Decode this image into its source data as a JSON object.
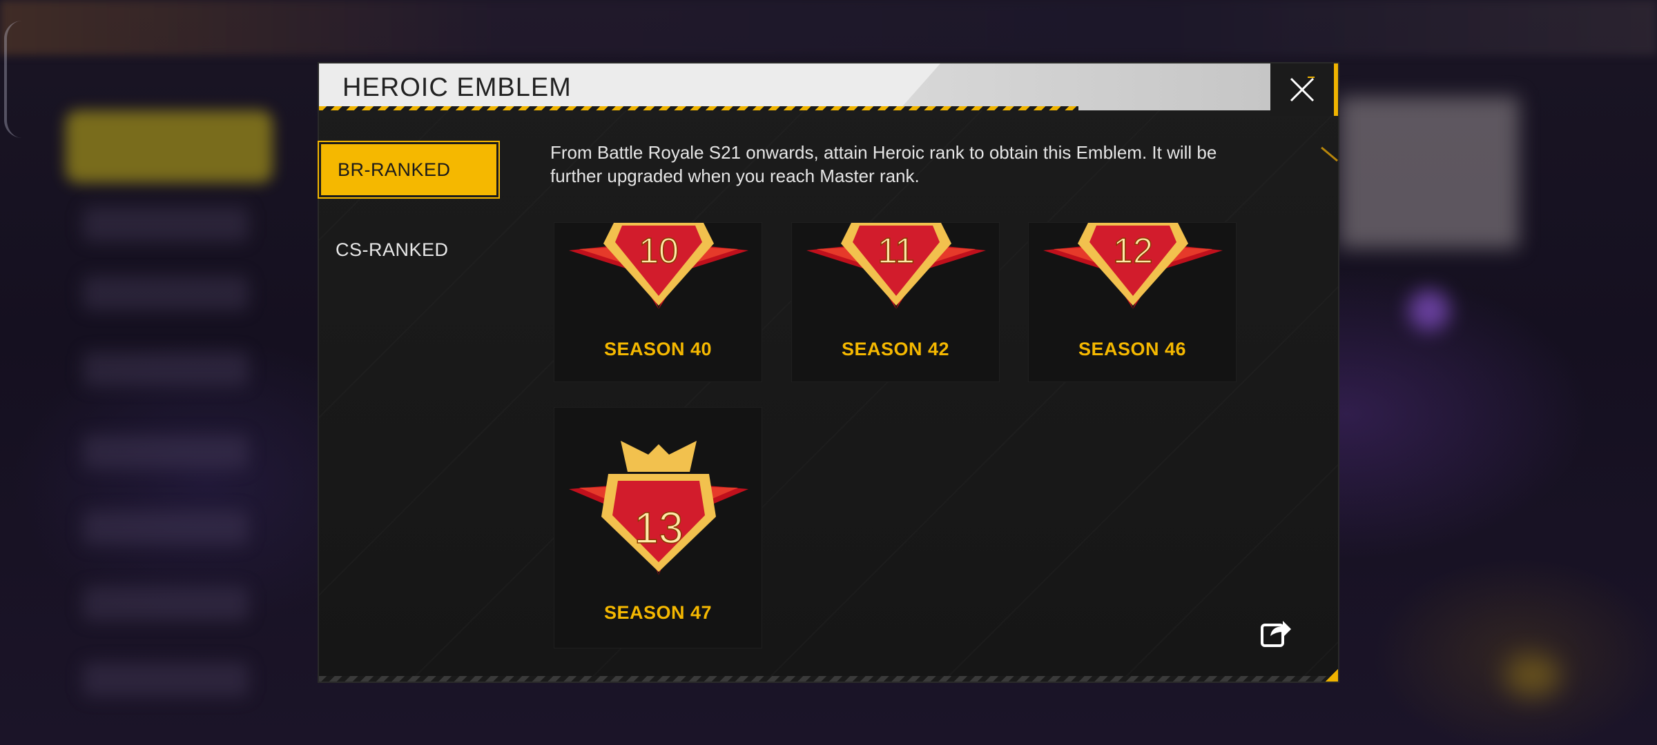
{
  "dialog": {
    "title": "HEROIC EMBLEM",
    "close_icon": "close-icon",
    "share_icon": "share-icon"
  },
  "tabs": [
    {
      "label": "BR-RANKED",
      "active": true
    },
    {
      "label": "CS-RANKED",
      "active": false
    }
  ],
  "description": "From Battle Royale S21 onwards, attain Heroic rank to obtain this Emblem. It will be further upgraded when you reach Master rank.",
  "emblems": [
    {
      "number": "10",
      "season": "SEASON 40"
    },
    {
      "number": "11",
      "season": "SEASON 42"
    },
    {
      "number": "12",
      "season": "SEASON 46"
    },
    {
      "number": "13",
      "season": "SEASON 47"
    }
  ],
  "colors": {
    "accent": "#f5b800",
    "emblem_red": "#d21c2c",
    "emblem_gold": "#f2c14e"
  }
}
